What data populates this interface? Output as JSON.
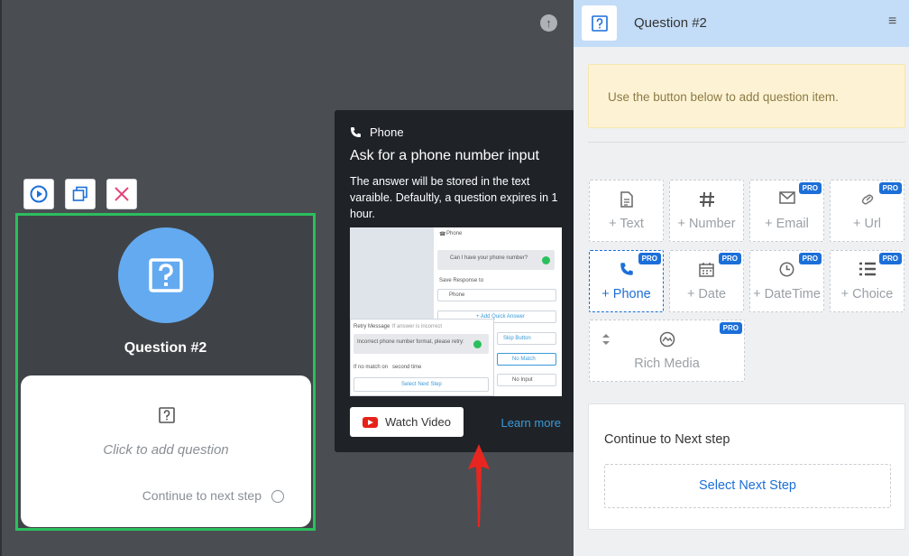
{
  "canvas": {
    "node": {
      "title": "Question #2",
      "placeholder": "Click to add question",
      "continue_label": "Continue to next step"
    }
  },
  "tooltip": {
    "header": "Phone",
    "title": "Ask for a phone number input",
    "description": "The answer will be stored in the text varaible. Defaultly, a question expires in 1 hour.",
    "preview": {
      "channel": "Phone",
      "question": "Can I have your phone number?",
      "save_label": "Save Response to",
      "save_value": "Phone",
      "add_quick_answer": "+ Add Quick Answer",
      "skip_button": "Skip Button",
      "no_match": "No Match",
      "no_input": "No Input",
      "retry_label": "Retry Message",
      "retry_hint": "If answer is incorrect",
      "retry_text": "Incorrect phone number format, please retry:",
      "if_no_match": "If no match on",
      "second_time": "second time",
      "select_next": "Select Next Step"
    },
    "watch_video": "Watch Video",
    "learn_more": "Learn more"
  },
  "panel": {
    "title": "Question #2",
    "notice": "Use the button below to add question item.",
    "items": [
      {
        "label": "+ Text",
        "icon": "text-doc-icon",
        "pro": ""
      },
      {
        "label": "+ Number",
        "icon": "hash-icon",
        "pro": ""
      },
      {
        "label": "+ Email",
        "icon": "envelope-icon",
        "pro": "PRO"
      },
      {
        "label": "+ Url",
        "icon": "link-icon",
        "pro": "PRO"
      },
      {
        "label": "+ Phone",
        "icon": "phone-icon",
        "pro": "PRO"
      },
      {
        "label": "+ Date",
        "icon": "calendar-icon",
        "pro": "PRO"
      },
      {
        "label": "+ DateTime",
        "icon": "clock-icon",
        "pro": "PRO"
      },
      {
        "label": "+ Choice",
        "icon": "list-icon",
        "pro": "PRO"
      },
      {
        "label": "Rich Media",
        "icon": "media-icon",
        "pro": "PRO"
      }
    ],
    "next_step": {
      "title": "Continue to Next step",
      "button": "Select Next Step"
    }
  },
  "colors": {
    "accent": "#1c6fd8",
    "node_border": "#2bbf5e",
    "avatar": "#64aaf0",
    "header": "#c3dcf7"
  }
}
